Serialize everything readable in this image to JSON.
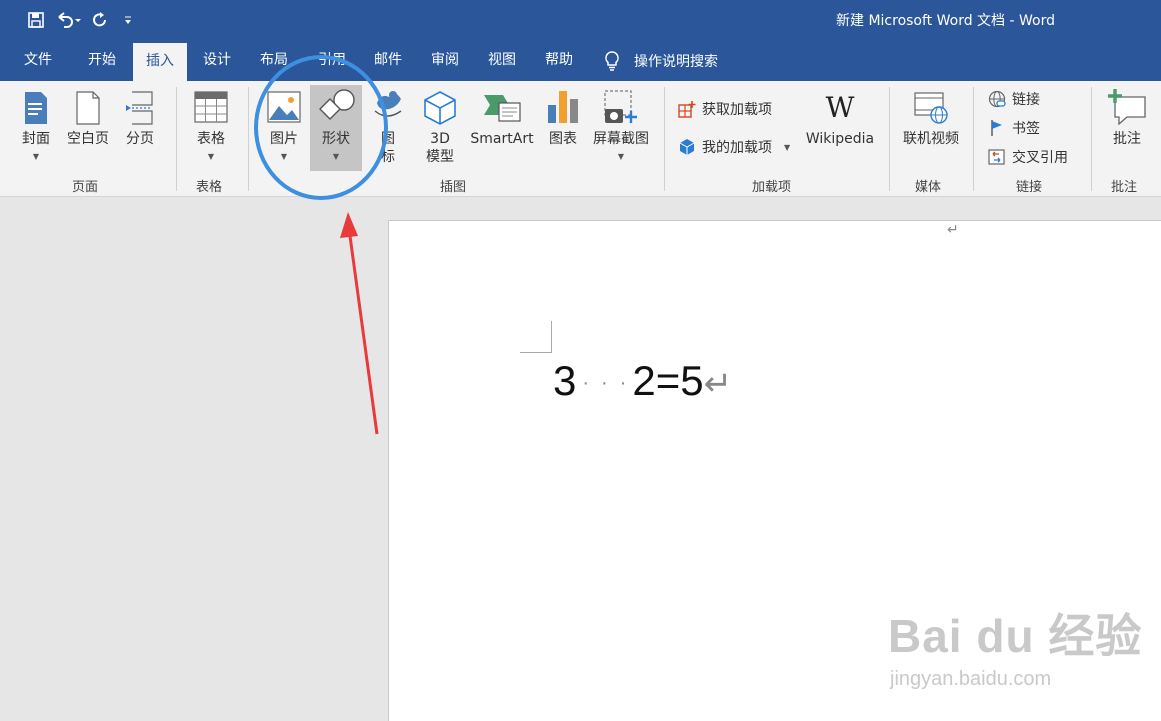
{
  "title": "新建 Microsoft Word 文档 - Word",
  "qat": {
    "customize_glyph": "≡"
  },
  "tabs": [
    {
      "label": "文件"
    },
    {
      "label": "开始"
    },
    {
      "label": "插入"
    },
    {
      "label": "设计"
    },
    {
      "label": "布局"
    },
    {
      "label": "引用"
    },
    {
      "label": "邮件"
    },
    {
      "label": "审阅"
    },
    {
      "label": "视图"
    },
    {
      "label": "帮助"
    }
  ],
  "active_tab": "插入",
  "tellme": "操作说明搜索",
  "ribbon": {
    "pages": {
      "cover": "封面",
      "blank": "空白页",
      "break": "分页",
      "group": "页面"
    },
    "tables": {
      "table": "表格",
      "group": "表格"
    },
    "illustrations": {
      "pictures": "图片",
      "shapes": "形状",
      "icons": "图\n标",
      "models_line1": "3D",
      "models_line2": "模型",
      "smartart": "SmartArt",
      "chart": "图表",
      "screenshot": "屏幕截图",
      "group": "插图"
    },
    "addins": {
      "get": "获取加载项",
      "mine": "我的加载项",
      "wikipedia": "Wikipedia",
      "group": "加载项"
    },
    "media": {
      "video": "联机视频",
      "group": "媒体"
    },
    "links": {
      "link": "链接",
      "bookmark": "书签",
      "crossref": "交叉引用",
      "group": "链接"
    },
    "comments": {
      "comment": "批注",
      "group": "批注"
    }
  },
  "document": {
    "eq_left": "3",
    "eq_right": "2=5",
    "para_mark": "↵"
  },
  "watermark": {
    "main": "Bai du 经验",
    "sub": "jingyan.baidu.com"
  },
  "colors": {
    "word_blue": "#2b579a",
    "annotation_blue": "#3d8fe0",
    "arrow_red": "#e83a3a"
  }
}
